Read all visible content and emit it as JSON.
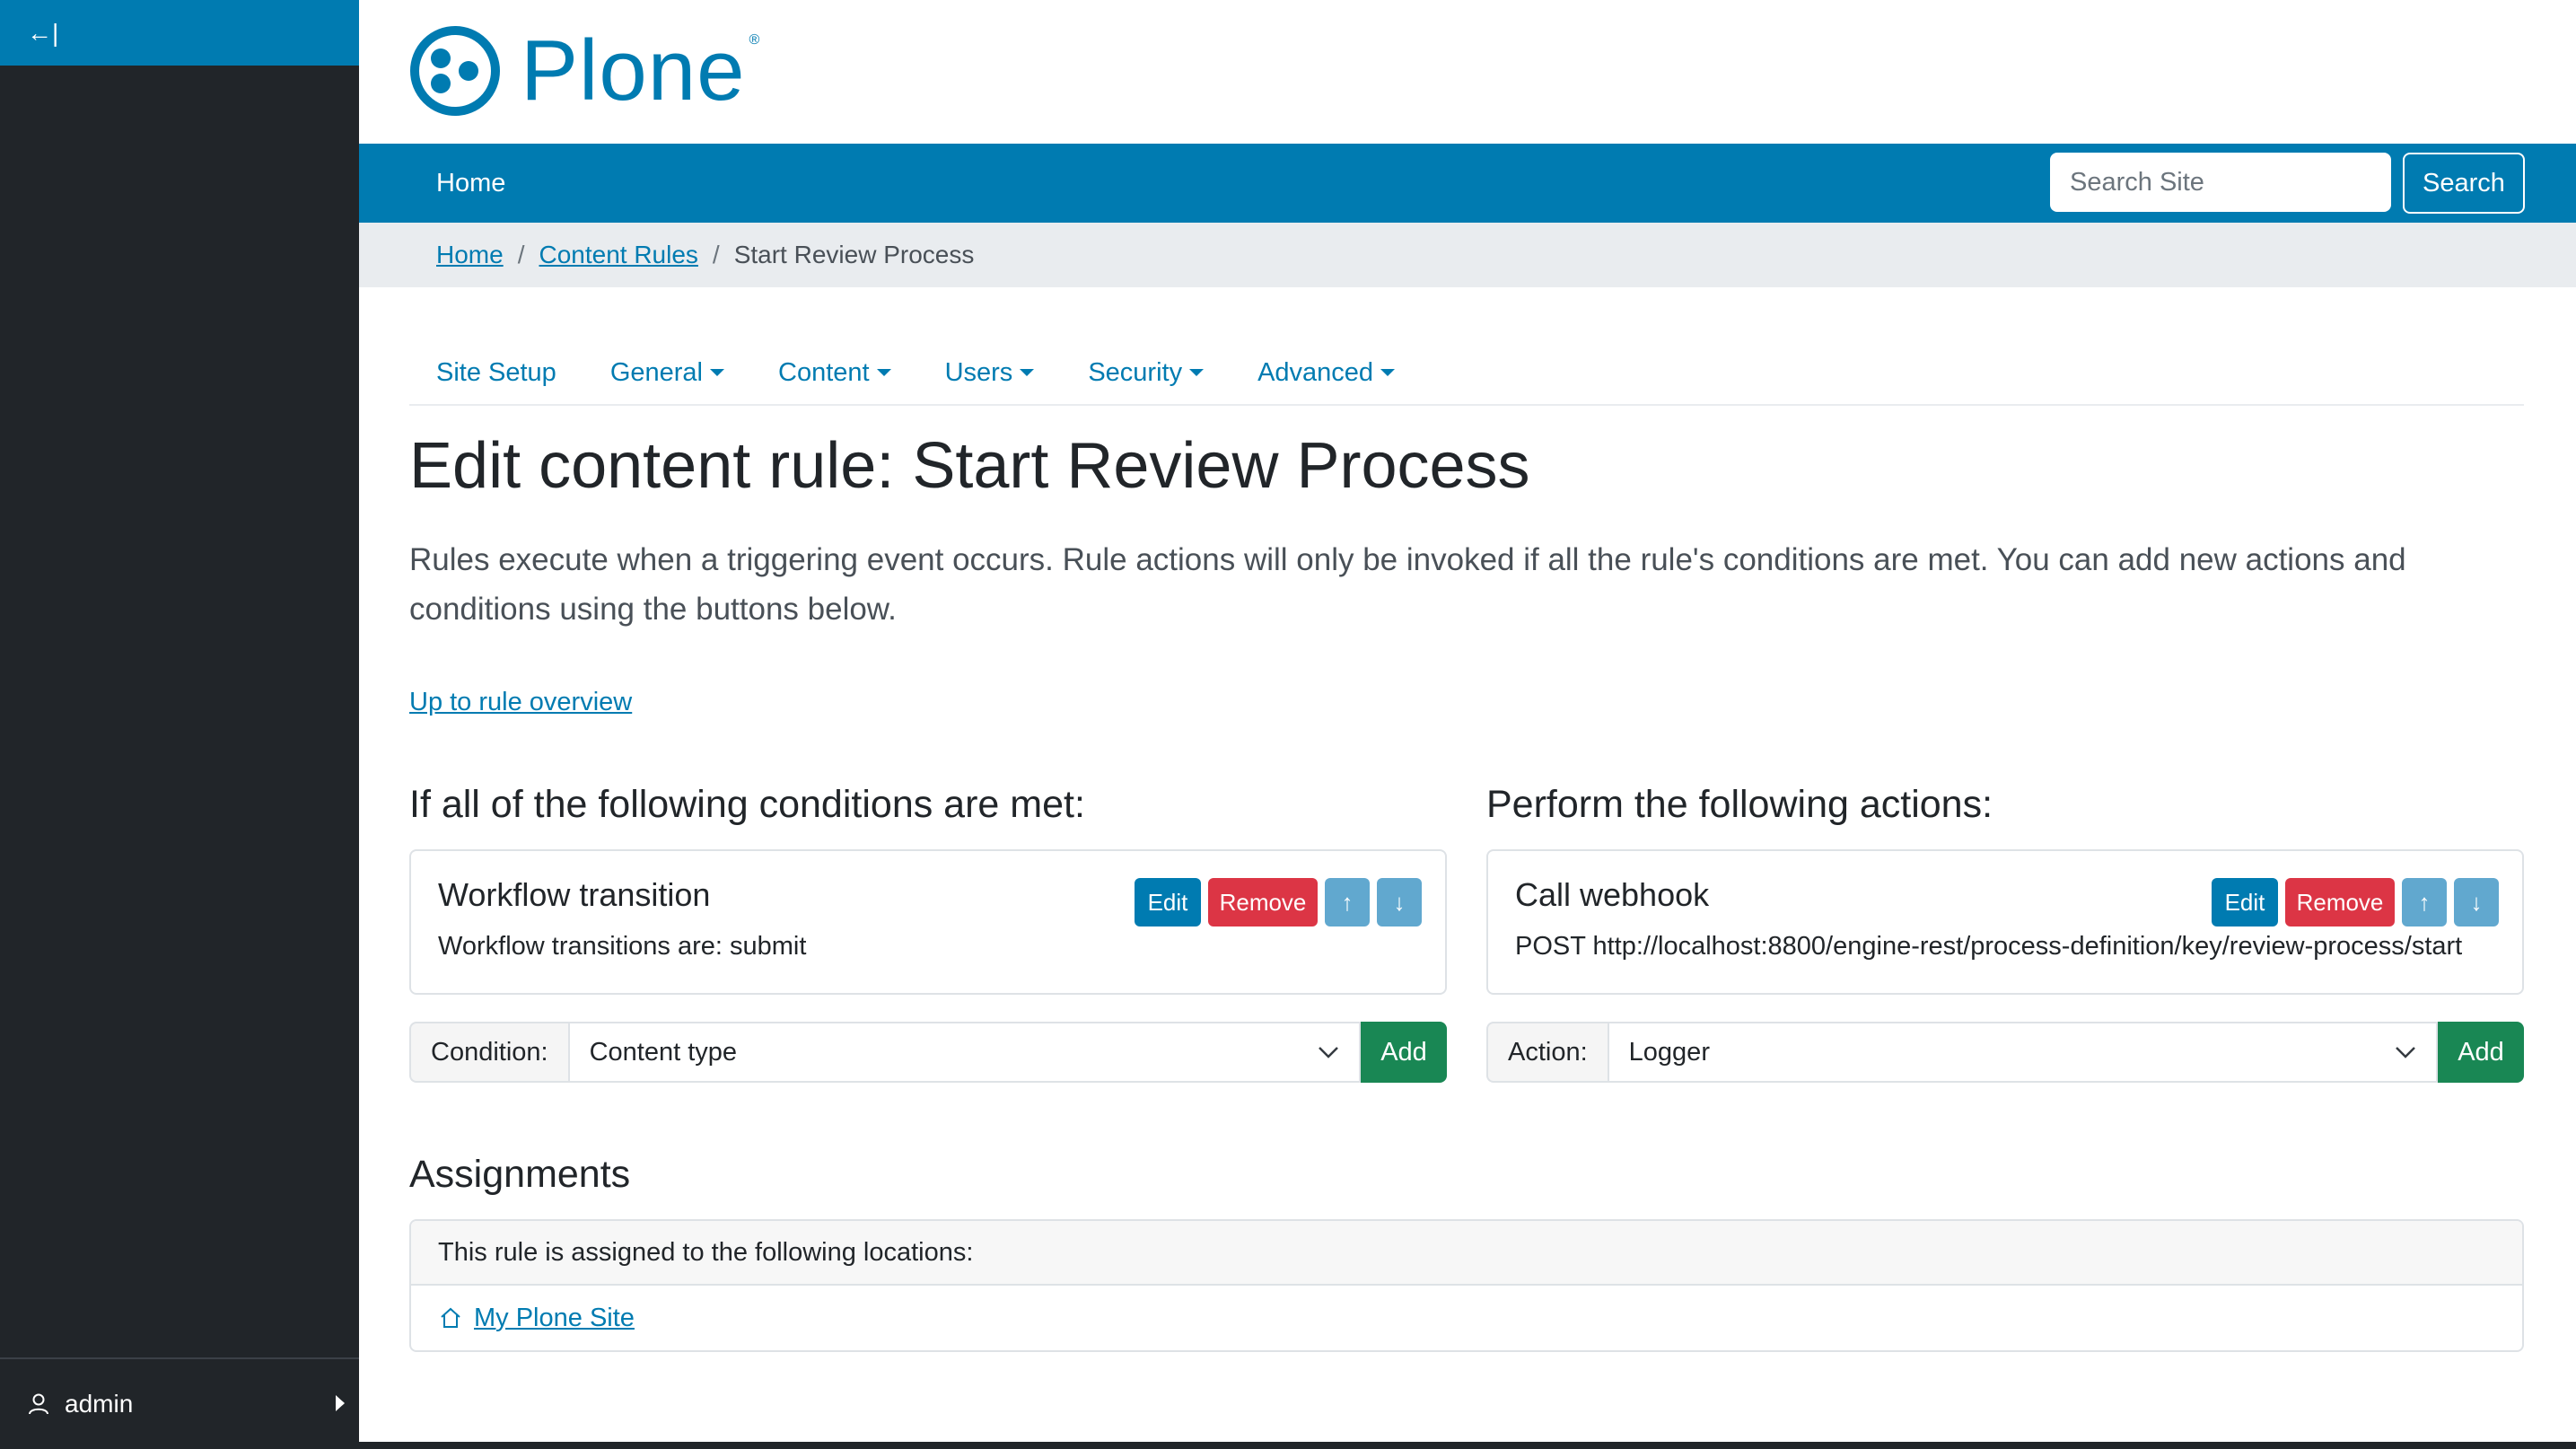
{
  "toolbar": {
    "collapse_glyph": "←|",
    "user": {
      "name": "admin"
    }
  },
  "site": {
    "logo_text": "Plone",
    "logo_reg": "®"
  },
  "navbar": {
    "home_label": "Home",
    "search_placeholder": "Search Site",
    "search_button": "Search"
  },
  "breadcrumbs": {
    "items": [
      {
        "label": "Home"
      },
      {
        "label": "Content Rules"
      },
      {
        "label": "Start Review Process"
      }
    ],
    "separator": "/"
  },
  "setup_nav": {
    "items": [
      {
        "label": "Site Setup"
      },
      {
        "label": "General"
      },
      {
        "label": "Content"
      },
      {
        "label": "Users"
      },
      {
        "label": "Security"
      },
      {
        "label": "Advanced"
      }
    ]
  },
  "page": {
    "title": "Edit content rule: Start Review Process",
    "description": "Rules execute when a triggering event occurs. Rule actions will only be invoked if all the rule's conditions are met. You can add new actions and conditions using the buttons below.",
    "up_link": "Up to rule overview"
  },
  "conditions": {
    "heading": "If all of the following conditions are met:",
    "item": {
      "title": "Workflow transition",
      "summary": "Workflow transitions are: submit",
      "edit_label": "Edit",
      "remove_label": "Remove",
      "up_label": "↑",
      "down_label": "↓"
    },
    "add_form": {
      "label": "Condition:",
      "selected": "Content type",
      "add_label": "Add"
    }
  },
  "actions": {
    "heading": "Perform the following actions:",
    "item": {
      "title": "Call webhook",
      "summary": "POST http://localhost:8800/engine-rest/process-definition/key/review-process/start",
      "edit_label": "Edit",
      "remove_label": "Remove",
      "up_label": "↑",
      "down_label": "↓"
    },
    "add_form": {
      "label": "Action:",
      "selected": "Logger",
      "add_label": "Add"
    }
  },
  "assignments": {
    "heading": "Assignments",
    "intro": "This rule is assigned to the following locations:",
    "locations": [
      {
        "label": "My Plone Site"
      }
    ]
  },
  "colors": {
    "brand": "#007bb1",
    "toolbar_bg": "#212529",
    "danger": "#dc3545",
    "success": "#198754"
  }
}
